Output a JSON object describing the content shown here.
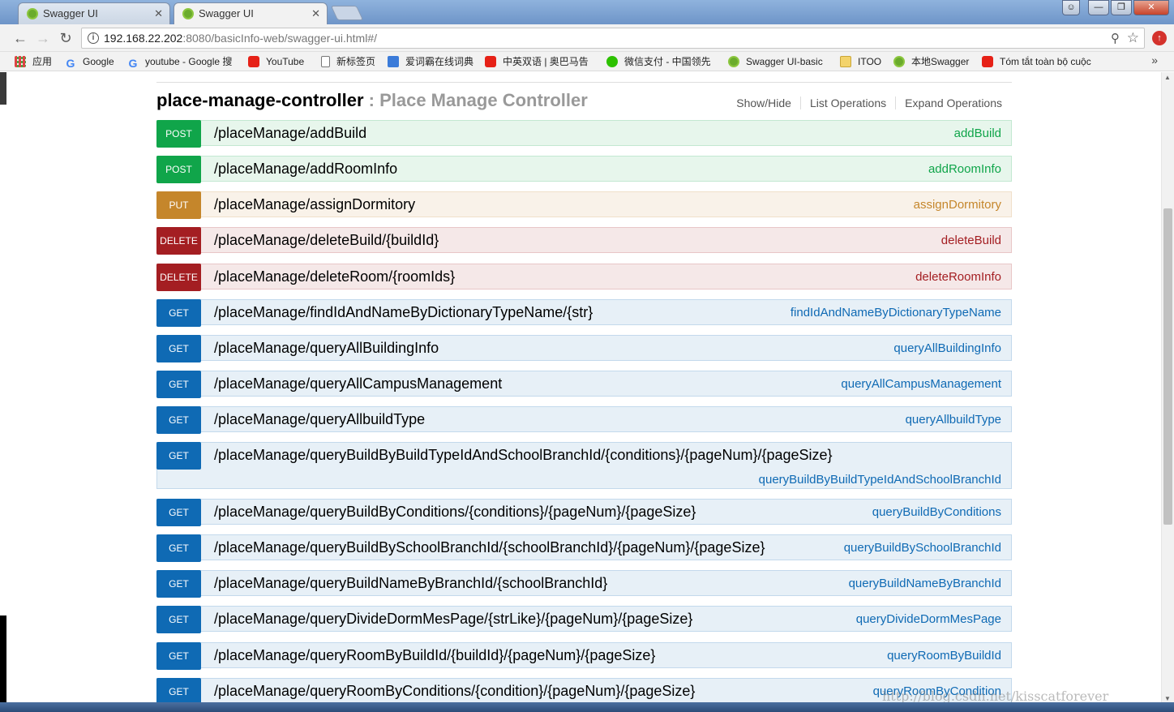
{
  "browser": {
    "tabs": [
      {
        "title": "Swagger UI",
        "active": false
      },
      {
        "title": "Swagger UI",
        "active": true
      }
    ],
    "url_host": "192.168.22.202",
    "url_rest": ":8080/basicInfo-web/swagger-ui.html#/",
    "bookmarks": [
      {
        "label": "应用",
        "icon": "apps-icon"
      },
      {
        "label": "Google",
        "icon": "google-icon"
      },
      {
        "label": "youtube - Google 搜",
        "icon": "google-icon"
      },
      {
        "label": "YouTube",
        "icon": "youtube-icon"
      },
      {
        "label": "新标签页",
        "icon": "page-icon"
      },
      {
        "label": "爱词霸在线词典",
        "icon": "dictionary-icon"
      },
      {
        "label": "中英双语 | 奥巴马告",
        "icon": "youtube-icon"
      },
      {
        "label": "微信支付 - 中国领先",
        "icon": "wechat-icon"
      },
      {
        "label": "Swagger UI-basic",
        "icon": "swagger-icon"
      },
      {
        "label": "ITOO",
        "icon": "folder-icon"
      },
      {
        "label": "本地Swagger",
        "icon": "swagger-icon"
      },
      {
        "label": "Tóm tắt toàn bộ cuộc",
        "icon": "youtube-icon"
      }
    ],
    "bookmarks_more": "»"
  },
  "controller": {
    "name": "place-manage-controller",
    "separator": " : ",
    "description": "Place Manage Controller",
    "links": [
      "Show/Hide",
      "List Operations",
      "Expand Operations"
    ]
  },
  "operations": [
    {
      "method": "POST",
      "path": "/placeManage/addBuild",
      "id": "addBuild"
    },
    {
      "method": "POST",
      "path": "/placeManage/addRoomInfo",
      "id": "addRoomInfo"
    },
    {
      "method": "PUT",
      "path": "/placeManage/assignDormitory",
      "id": "assignDormitory"
    },
    {
      "method": "DELETE",
      "path": "/placeManage/deleteBuild/{buildId}",
      "id": "deleteBuild"
    },
    {
      "method": "DELETE",
      "path": "/placeManage/deleteRoom/{roomIds}",
      "id": "deleteRoomInfo"
    },
    {
      "method": "GET",
      "path": "/placeManage/findIdAndNameByDictionaryTypeName/{str}",
      "id": "findIdAndNameByDictionaryTypeName"
    },
    {
      "method": "GET",
      "path": "/placeManage/queryAllBuildingInfo",
      "id": "queryAllBuildingInfo"
    },
    {
      "method": "GET",
      "path": "/placeManage/queryAllCampusManagement",
      "id": "queryAllCampusManagement"
    },
    {
      "method": "GET",
      "path": "/placeManage/queryAllbuildType",
      "id": "queryAllbuildType"
    },
    {
      "method": "GET",
      "path": "/placeManage/queryBuildByBuildTypeIdAndSchoolBranchId/{conditions}/{pageNum}/{pageSize}",
      "id": "queryBuildByBuildTypeIdAndSchoolBranchId"
    },
    {
      "method": "GET",
      "path": "/placeManage/queryBuildByConditions/{conditions}/{pageNum}/{pageSize}",
      "id": "queryBuildByConditions"
    },
    {
      "method": "GET",
      "path": "/placeManage/queryBuildBySchoolBranchId/{schoolBranchId}/{pageNum}/{pageSize}",
      "id": "queryBuildBySchoolBranchId"
    },
    {
      "method": "GET",
      "path": "/placeManage/queryBuildNameByBranchId/{schoolBranchId}",
      "id": "queryBuildNameByBranchId"
    },
    {
      "method": "GET",
      "path": "/placeManage/queryDivideDormMesPage/{strLike}/{pageNum}/{pageSize}",
      "id": "queryDivideDormMesPage"
    },
    {
      "method": "GET",
      "path": "/placeManage/queryRoomByBuildId/{buildId}/{pageNum}/{pageSize}",
      "id": "queryRoomByBuildId"
    },
    {
      "method": "GET",
      "path": "/placeManage/queryRoomByConditions/{condition}/{pageNum}/{pageSize}",
      "id": "queryRoomByCondition"
    }
  ],
  "watermark": "http://blog.csdn.net/kisscatforever",
  "colors": {
    "post": "#10a54a",
    "put": "#c5862b",
    "delete": "#a41e22",
    "get": "#0f6ab4"
  }
}
